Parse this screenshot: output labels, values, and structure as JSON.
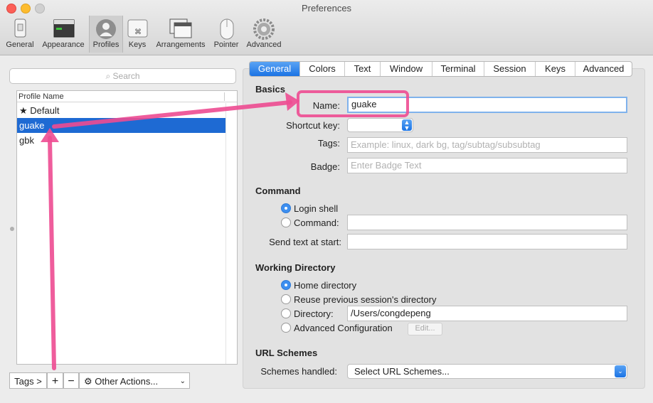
{
  "window": {
    "title": "Preferences"
  },
  "toolbar": [
    {
      "label": "General",
      "icon": "phone-icon"
    },
    {
      "label": "Appearance",
      "icon": "terminal-window-icon"
    },
    {
      "label": "Profiles",
      "icon": "user-silhouette-icon"
    },
    {
      "label": "Keys",
      "icon": "command-key-icon"
    },
    {
      "label": "Arrangements",
      "icon": "window-arrangement-icon"
    },
    {
      "label": "Pointer",
      "icon": "mouse-icon"
    },
    {
      "label": "Advanced",
      "icon": "gear-icon"
    }
  ],
  "search": {
    "placeholder": "Search"
  },
  "profile_list": {
    "header": "Profile Name",
    "items": [
      {
        "label": "★ Default",
        "selected": false
      },
      {
        "label": "guake",
        "selected": true
      },
      {
        "label": "gbk",
        "selected": false
      }
    ]
  },
  "bottom_bar": {
    "tags": "Tags >",
    "add": "+",
    "remove": "−",
    "other": "Other Actions..."
  },
  "tabs": [
    "General",
    "Colors",
    "Text",
    "Window",
    "Terminal",
    "Session",
    "Keys",
    "Advanced"
  ],
  "basics": {
    "title": "Basics",
    "name_label": "Name:",
    "name_value": "guake",
    "shortcut_label": "Shortcut key:",
    "tags_label": "Tags:",
    "tags_placeholder": "Example: linux, dark bg, tag/subtag/subsubtag",
    "badge_label": "Badge:",
    "badge_placeholder": "Enter Badge Text"
  },
  "command": {
    "title": "Command",
    "login_shell": "Login shell",
    "command": "Command:",
    "send_text_label": "Send text at start:"
  },
  "working_directory": {
    "title": "Working Directory",
    "home": "Home directory",
    "reuse": "Reuse previous session's directory",
    "directory": "Directory:",
    "directory_value": "/Users/congdepeng",
    "advanced": "Advanced Configuration",
    "edit": "Edit..."
  },
  "url_schemes": {
    "title": "URL Schemes",
    "handled_label": "Schemes handled:",
    "select_value": "Select URL Schemes..."
  },
  "annotation_color": "#ee4c92"
}
